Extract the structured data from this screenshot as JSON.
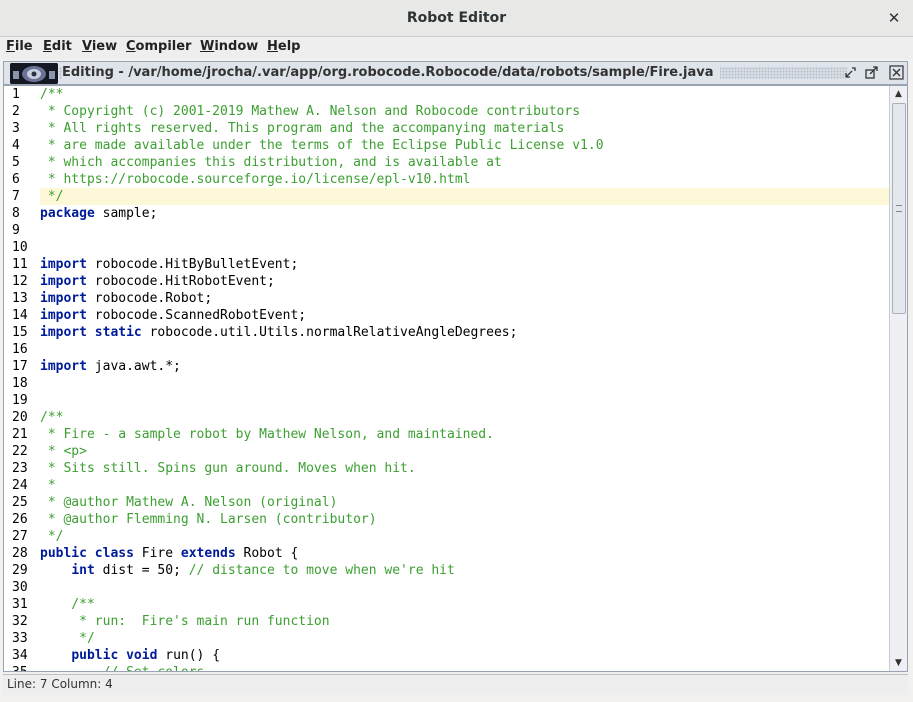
{
  "window": {
    "title": "Robot Editor",
    "close_glyph": "✕"
  },
  "menu": [
    {
      "mnemonic": "F",
      "rest": "ile"
    },
    {
      "mnemonic": "E",
      "rest": "dit"
    },
    {
      "mnemonic": "V",
      "rest": "iew"
    },
    {
      "mnemonic": "C",
      "rest": "ompiler"
    },
    {
      "mnemonic": "W",
      "rest": "indow"
    },
    {
      "mnemonic": "H",
      "rest": "elp"
    }
  ],
  "editor_frame": {
    "title": "Editing - /var/home/jrocha/.var/app/org.robocode.Robocode/data/robots/sample/Fire.java",
    "icon": "robocode-robot-icon",
    "controls": [
      "minimize-icon",
      "maximize-icon",
      "close-icon"
    ]
  },
  "editor": {
    "highlighted_line": 7,
    "lines": [
      [
        [
          "cm",
          "/**"
        ]
      ],
      [
        [
          "cm",
          " * Copyright (c) 2001-2019 Mathew A. Nelson and Robocode contributors"
        ]
      ],
      [
        [
          "cm",
          " * All rights reserved. This program and the accompanying materials"
        ]
      ],
      [
        [
          "cm",
          " * are made available under the terms of the Eclipse Public License v1.0"
        ]
      ],
      [
        [
          "cm",
          " * which accompanies this distribution, and is available at"
        ]
      ],
      [
        [
          "cm",
          " * https://robocode.sourceforge.io/license/epl-v10.html"
        ]
      ],
      [
        [
          "cm",
          " */"
        ]
      ],
      [
        [
          "kw",
          "package"
        ],
        [
          "",
          " sample;"
        ]
      ],
      [],
      [],
      [
        [
          "kw",
          "import"
        ],
        [
          "",
          " robocode.HitByBulletEvent;"
        ]
      ],
      [
        [
          "kw",
          "import"
        ],
        [
          "",
          " robocode.HitRobotEvent;"
        ]
      ],
      [
        [
          "kw",
          "import"
        ],
        [
          "",
          " robocode.Robot;"
        ]
      ],
      [
        [
          "kw",
          "import"
        ],
        [
          "",
          " robocode.ScannedRobotEvent;"
        ]
      ],
      [
        [
          "kw",
          "import"
        ],
        [
          "",
          " "
        ],
        [
          "kw",
          "static"
        ],
        [
          "",
          " robocode.util.Utils.normalRelativeAngleDegrees;"
        ]
      ],
      [],
      [
        [
          "kw",
          "import"
        ],
        [
          "",
          " java.awt.*;"
        ]
      ],
      [],
      [],
      [
        [
          "cm",
          "/**"
        ]
      ],
      [
        [
          "cm",
          " * Fire - a sample robot by Mathew Nelson, and maintained."
        ]
      ],
      [
        [
          "cm",
          " * <p>"
        ]
      ],
      [
        [
          "cm",
          " * Sits still. Spins gun around. Moves when hit."
        ]
      ],
      [
        [
          "cm",
          " *"
        ]
      ],
      [
        [
          "cm",
          " * @author Mathew A. Nelson (original)"
        ]
      ],
      [
        [
          "cm",
          " * @author Flemming N. Larsen (contributor)"
        ]
      ],
      [
        [
          "cm",
          " */"
        ]
      ],
      [
        [
          "kw",
          "public"
        ],
        [
          "",
          " "
        ],
        [
          "kw",
          "class"
        ],
        [
          "",
          " Fire "
        ],
        [
          "kw",
          "extends"
        ],
        [
          "",
          " Robot {"
        ]
      ],
      [
        [
          "",
          "    "
        ],
        [
          "kw",
          "int"
        ],
        [
          "",
          " dist = 50; "
        ],
        [
          "cm",
          "// distance to move when we're hit"
        ]
      ],
      [],
      [
        [
          "cm",
          "    /**"
        ]
      ],
      [
        [
          "cm",
          "     * run:  Fire's main run function"
        ]
      ],
      [
        [
          "cm",
          "     */"
        ]
      ],
      [
        [
          "",
          "    "
        ],
        [
          "kw",
          "public"
        ],
        [
          "",
          " "
        ],
        [
          "kw",
          "void"
        ],
        [
          "",
          " run() {"
        ]
      ],
      [
        [
          "cm",
          "        // Set colors"
        ]
      ]
    ]
  },
  "scrollbar": {
    "position_fraction": 0.0,
    "visible_fraction": 0.38,
    "up_glyph": "▲",
    "down_glyph": "▼"
  },
  "status": {
    "text": "Line: 7 Column: 4"
  }
}
